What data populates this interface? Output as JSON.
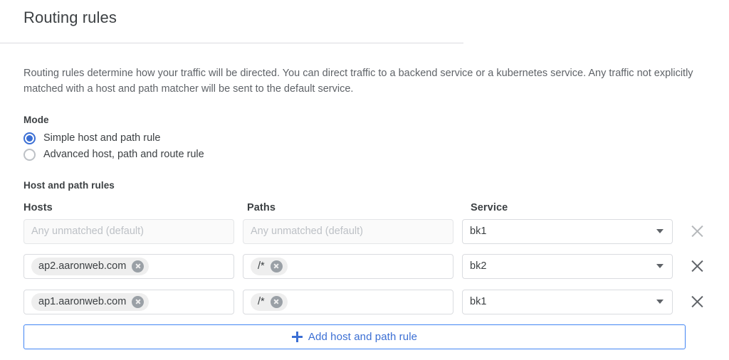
{
  "header": {
    "title": "Routing rules"
  },
  "description": "Routing rules determine how your traffic will be directed. You can direct traffic to a backend service or a kubernetes service. Any traffic not explicitly matched with a host and path matcher will be sent to the default service.",
  "mode": {
    "label": "Mode",
    "options": [
      {
        "label": "Simple host and path rule",
        "selected": true
      },
      {
        "label": "Advanced host, path and route rule",
        "selected": false
      }
    ]
  },
  "host_and_path_rules": {
    "label": "Host and path rules",
    "columns": {
      "hosts": "Hosts",
      "paths": "Paths",
      "service": "Service"
    },
    "rows": [
      {
        "hosts_placeholder": "Any unmatched (default)",
        "paths_placeholder": "Any unmatched (default)",
        "hosts_chip": "",
        "paths_chip": "",
        "service": "bk1",
        "delete_icon": "close-icon"
      },
      {
        "hosts_placeholder": "",
        "paths_placeholder": "",
        "hosts_chip": "ap2.aaronweb.com",
        "paths_chip": "/*",
        "service": "bk2",
        "delete_icon": "close-icon"
      },
      {
        "hosts_placeholder": "",
        "paths_placeholder": "",
        "hosts_chip": "ap1.aaronweb.com",
        "paths_chip": "/*",
        "service": "bk1",
        "delete_icon": "close-icon"
      }
    ],
    "add_button": {
      "label": "Add host and path rule",
      "icon": "plus-icon"
    }
  },
  "colors": {
    "accent_blue": "#3b6fd4",
    "button_border_blue": "#4285f4",
    "text_primary": "#3c4043",
    "text_secondary": "#5f6368",
    "placeholder": "#bdc1c6",
    "chip_bg": "#eeeeee",
    "border": "#dadce0"
  }
}
